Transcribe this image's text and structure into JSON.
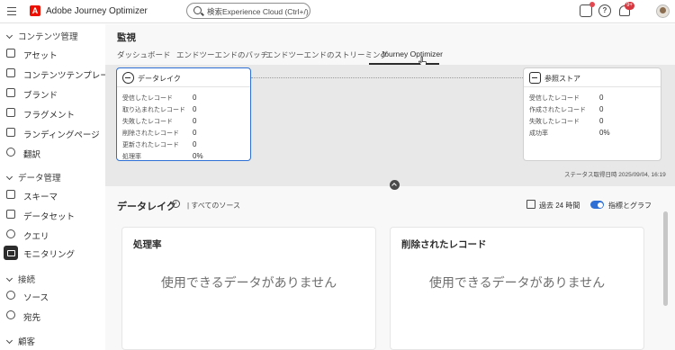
{
  "topbar": {
    "app_title": "Adobe Journey Optimizer",
    "logo_letter": "A",
    "search_placeholder": "検索Experience Cloud (Ctrl+/)",
    "notification_count": "9+"
  },
  "sidebar": {
    "sections": [
      {
        "label": "コンテンツ管理"
      },
      {
        "label": "データ管理"
      },
      {
        "label": "接続"
      },
      {
        "label": "顧客"
      }
    ],
    "items": [
      {
        "label": "アセット",
        "icon": "asset-icon"
      },
      {
        "label": "コンテンツテンプレート",
        "icon": "template-icon"
      },
      {
        "label": "ブランド",
        "icon": "brand-icon"
      },
      {
        "label": "フラグメント",
        "icon": "fragment-icon"
      },
      {
        "label": "ランディングページ",
        "icon": "landing-page-icon"
      },
      {
        "label": "翻訳",
        "icon": "globe-icon"
      },
      {
        "label": "スキーマ",
        "icon": "schema-icon"
      },
      {
        "label": "データセット",
        "icon": "dataset-icon"
      },
      {
        "label": "クエリ",
        "icon": "query-icon"
      },
      {
        "label": "モニタリング",
        "icon": "monitoring-icon"
      },
      {
        "label": "ソース",
        "icon": "source-icon"
      },
      {
        "label": "宛先",
        "icon": "destination-icon"
      }
    ]
  },
  "main": {
    "page_title": "監視",
    "tabs": [
      {
        "label": "ダッシュボード"
      },
      {
        "label": "エンドツーエンドのバッチ"
      },
      {
        "label": "エンドツーエンドのストリーミング"
      },
      {
        "label": "Journey Optimizer"
      }
    ],
    "active_tab": "Journey Optimizer",
    "datalake_node": {
      "title": "データレイク",
      "metrics": [
        {
          "label": "受信したレコード",
          "value": "0"
        },
        {
          "label": "取り込まれたレコード",
          "value": "0"
        },
        {
          "label": "失敗したレコード",
          "value": "0"
        },
        {
          "label": "削除されたレコード",
          "value": "0"
        },
        {
          "label": "更新されたレコード",
          "value": "0"
        },
        {
          "label": "処理率",
          "value": "0%"
        }
      ]
    },
    "reference_node": {
      "title": "参照ストア",
      "metrics": [
        {
          "label": "受信したレコード",
          "value": "0"
        },
        {
          "label": "作成されたレコード",
          "value": "0"
        },
        {
          "label": "失敗したレコード",
          "value": "0"
        },
        {
          "label": "成功率",
          "value": "0%"
        }
      ]
    },
    "status_time": "ステータス取得日時 2025/09/04, 16:19",
    "section": {
      "title": "データレイク",
      "sources": "| すべてのソース",
      "range": "過去 24 時間",
      "toggle_label": "指標とグラフ",
      "toggle_on": true
    },
    "cards": [
      {
        "title": "処理率",
        "empty": "使用できるデータがありません"
      },
      {
        "title": "削除されたレコード",
        "empty": "使用できるデータがありません"
      }
    ]
  },
  "colors": {
    "accent": "#2d6fd4",
    "brand": "#eb1000",
    "badge": "#d7373f"
  }
}
